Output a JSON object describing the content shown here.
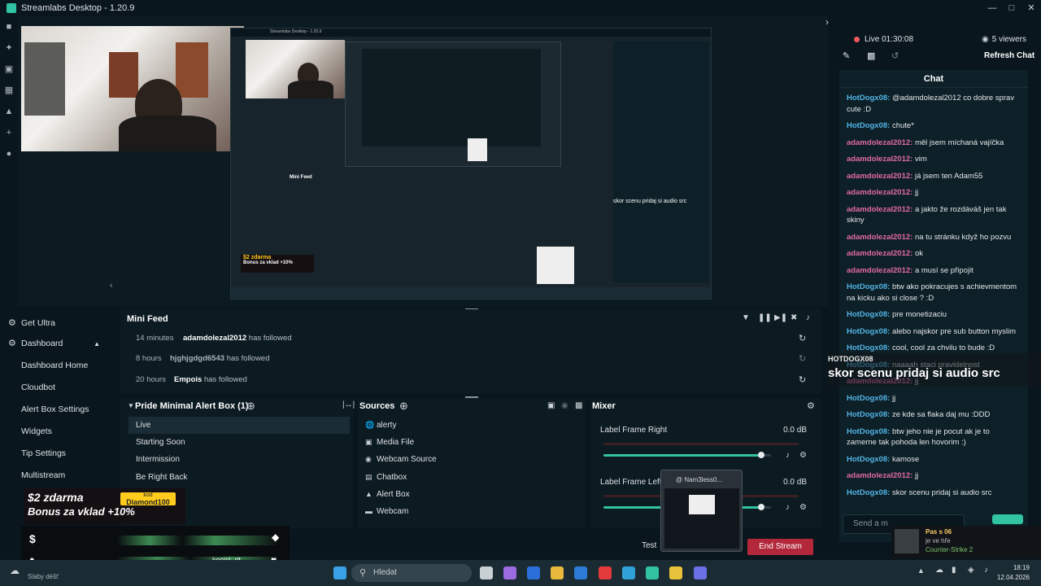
{
  "app": {
    "title": "Streamlabs Desktop - 1.20.9",
    "accent": "#31c3a2",
    "danger": "#b2273a"
  },
  "window_controls": [
    "minimize-icon",
    "maximize-icon",
    "close-icon"
  ],
  "live": {
    "status": "Live 01:30:08",
    "viewers": "5 viewers",
    "refresh": "Refresh Chat"
  },
  "chat": {
    "title": "Chat",
    "input_placeholder": "Send a m",
    "messages": [
      {
        "user": "HotDogx08:",
        "kind": "hot",
        "text": "@adamdolezal2012 co dobre sprav cute :D"
      },
      {
        "user": "HotDogx08:",
        "kind": "hot",
        "text": "chute*"
      },
      {
        "user": "adamdolezal2012:",
        "kind": "adam",
        "text": "měl jsem míchaná vajíčka"
      },
      {
        "user": "adamdolezal2012:",
        "kind": "adam",
        "text": "vim"
      },
      {
        "user": "adamdolezal2012:",
        "kind": "adam",
        "text": "já jsem ten Adam55"
      },
      {
        "user": "adamdolezal2012:",
        "kind": "adam",
        "text": "jj"
      },
      {
        "user": "adamdolezal2012:",
        "kind": "adam",
        "text": "a jakto že rozdáváš jen tak skiny"
      },
      {
        "user": "adamdolezal2012:",
        "kind": "adam",
        "text": "na tu stránku když ho pozvu"
      },
      {
        "user": "adamdolezal2012:",
        "kind": "adam",
        "text": "ok"
      },
      {
        "user": "adamdolezal2012:",
        "kind": "adam",
        "text": "a musí se připojit"
      },
      {
        "user": "HotDogx08:",
        "kind": "hot",
        "text": "btw ako pokracujes s achievmentom na kicku ako si close ? :D"
      },
      {
        "user": "HotDogx08:",
        "kind": "hot",
        "text": "pre monetizaciu"
      },
      {
        "user": "HotDogx08:",
        "kind": "hot",
        "text": "alebo najskor pre sub button myslim"
      },
      {
        "user": "HotDogx08:",
        "kind": "hot",
        "text": "cool, cool za chvilu to bude :D"
      },
      {
        "user": "HotDogx08:",
        "kind": "hot",
        "text": "naaaah staci pravidelnost"
      },
      {
        "user": "adamdolezal2012:",
        "kind": "adam",
        "text": "jj"
      },
      {
        "user": "HotDogx08:",
        "kind": "hot",
        "text": "jj"
      },
      {
        "user": "HotDogx08:",
        "kind": "hot",
        "text": "ze kde sa flaka daj mu :DDD"
      },
      {
        "user": "HotDogx08:",
        "kind": "hot",
        "text": "btw jeho nie je pocut ak je to zamerne tak pohoda len hovorim :)"
      },
      {
        "user": "HotDogx08:",
        "kind": "hot",
        "text": "kamose"
      },
      {
        "user": "adamdolezal2012:",
        "kind": "adam",
        "text": "jj"
      },
      {
        "user": "HotDogx08:",
        "kind": "hot",
        "text": "skor scenu pridaj si audio src"
      }
    ]
  },
  "alert_overlay": {
    "user": "HOTDOGX08",
    "text": "skor scenu pridaj si audio src"
  },
  "sidebar": {
    "get_ultra": "Get Ultra",
    "dashboard": "Dashboard",
    "items": [
      "Dashboard Home",
      "Cloudbot",
      "Alert Box Settings",
      "Widgets",
      "Tip Settings",
      "Multistream"
    ]
  },
  "minifeed": {
    "title": "Mini Feed",
    "rows": [
      {
        "time": "14 minutes",
        "name": "adamdolezal2012",
        "action": "has followed"
      },
      {
        "time": "8 hours",
        "name": "hjghjgdgd6543",
        "action": "has followed"
      },
      {
        "time": "20 hours",
        "name": "Empois",
        "action": "has followed"
      }
    ]
  },
  "scenes": {
    "title": "Pride Minimal Alert Box (1)",
    "items": [
      "Live",
      "Starting Soon",
      "Intermission",
      "Be Right Back"
    ],
    "selected": "Live"
  },
  "sources": {
    "title": "Sources",
    "items": [
      {
        "label": "alerty",
        "icon": "globe-icon"
      },
      {
        "label": "Media File",
        "icon": "file-icon"
      },
      {
        "label": "Webcam Source",
        "icon": "camera-icon"
      },
      {
        "label": "Chatbox",
        "icon": "chat-icon"
      },
      {
        "label": "Alert Box",
        "icon": "alert-icon"
      },
      {
        "label": "Webcam",
        "icon": "folder-icon"
      }
    ]
  },
  "mixer": {
    "title": "Mixer",
    "channels": [
      {
        "label": "Label Frame Right",
        "db": "0.0 dB",
        "level": 0.94
      },
      {
        "label": "Label Frame Left",
        "db": "0.0 dB",
        "level": 0.94
      }
    ]
  },
  "footer": {
    "test": "Test",
    "end_stream": "End Stream",
    "stream_fps": "kocici_rit"
  },
  "promo": {
    "line1": "$2 zdarma",
    "line2": "Bonus za vklad +10%",
    "code_label": "kod",
    "code": "Diamond100"
  },
  "thumb": {
    "label": "@ Nam3less0..."
  },
  "toast": {
    "line1": "Pas s 06",
    "line2": "je ve hře",
    "line3": "Counter-Strike 2"
  },
  "taskbar": {
    "search": "Hledat",
    "weather": "Slaby déšť",
    "time": "18:19",
    "date": "12.04.2026"
  },
  "preview": {
    "mini_title": "Streamlabs Desktop - 1.20.9",
    "mini_minifeed": "Mini Feed",
    "mini_overlay": "skor scenu pridaj si audio src",
    "mini_promo1": "$2 zdarma",
    "mini_promo2": "Bonus za vklad +10%"
  }
}
